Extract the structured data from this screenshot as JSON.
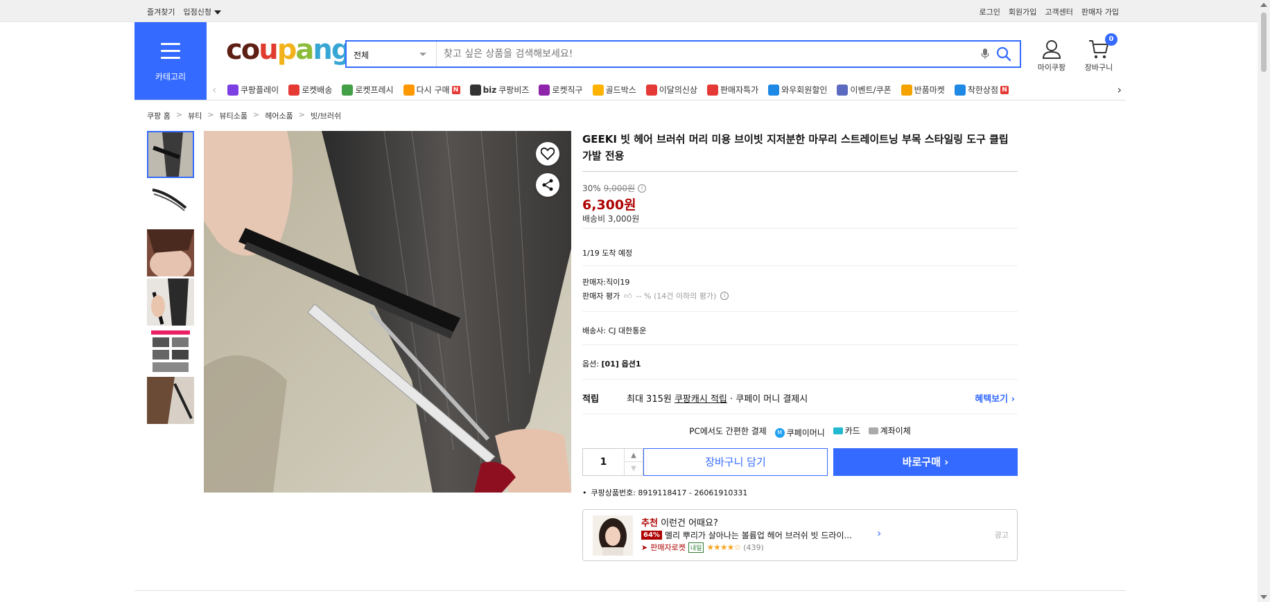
{
  "topbar": {
    "left": [
      "즐겨찾기",
      "입점신청"
    ],
    "right": [
      "로그인",
      "회원가입",
      "고객센터",
      "판매자 가입"
    ]
  },
  "header": {
    "category_label": "카테고리",
    "logo_text": "coupang",
    "search_category": "전체",
    "search_placeholder": "찾고 싶은 상품을 검색해보세요!",
    "mycoupang_label": "마이쿠팡",
    "cart_label": "장바구니",
    "cart_count": "0"
  },
  "nav": {
    "items": [
      {
        "label": "쿠팡플레이",
        "icon": "play-icon",
        "color": "#7b3fe4"
      },
      {
        "label": "로켓배송",
        "icon": "rocket-icon",
        "color": "#e53935"
      },
      {
        "label": "로켓프레시",
        "icon": "rocket-fresh-icon",
        "color": "#43a047"
      },
      {
        "label": "다시 구매",
        "icon": "bag-icon",
        "color": "#ff9800",
        "badge": "N"
      },
      {
        "label": "쿠팡비즈",
        "icon": "biz-icon",
        "color": "#333333",
        "prefix": "biz"
      },
      {
        "label": "로켓직구",
        "icon": "global-icon",
        "color": "#8e24aa"
      },
      {
        "label": "골드박스",
        "icon": "goldbox-icon",
        "color": "#ffb300"
      },
      {
        "label": "이달의신상",
        "icon": "new-icon",
        "color": "#e53935"
      },
      {
        "label": "판매자특가",
        "icon": "percent-icon",
        "color": "#e53935"
      },
      {
        "label": "와우회원할인",
        "icon": "wow-icon",
        "color": "#1e88e5"
      },
      {
        "label": "이벤트/쿠폰",
        "icon": "coupon-icon",
        "color": "#5c6bc0"
      },
      {
        "label": "반품마켓",
        "icon": "market-icon",
        "color": "#f4a300"
      },
      {
        "label": "착한상점",
        "icon": "store-icon",
        "color": "#1e88e5",
        "badge": "N"
      }
    ]
  },
  "breadcrumb": [
    "쿠팡 홈",
    "뷰티",
    "뷰티소품",
    "헤어소품",
    "빗/브러쉬"
  ],
  "product": {
    "title": "GEEKI 빗 헤어 브러쉬 머리 미용 브이빗 지저분한 마무리 스트레이트닝 부목 스타일링 도구 클립 가발 전용",
    "discount": "30%",
    "original_price": "9,000원",
    "price": "6,300원",
    "shipping": "배송비 3,000원",
    "arrival": "1/19 도착 예정",
    "seller_label": "판매자:",
    "seller": "직이19",
    "seller_rating_label": "판매자 평가",
    "seller_rating": "-- % (14건 이하의 평가)",
    "carrier_label": "배송사:",
    "carrier": "CJ 대한통운",
    "option_label": "옵션:",
    "option": "[01] 옵션1",
    "reward_label": "적립",
    "reward_prefix": "최대 315원",
    "reward_link": "쿠팡캐시 적립",
    "reward_suffix": "· 쿠페이 머니 결제시",
    "reward_more": "혜택보기",
    "pay_title": "PC에서도 간편한 결제",
    "pay_methods": [
      "쿠페이머니",
      "카드",
      "계좌이체"
    ],
    "quantity": "1",
    "add_to_cart": "장바구니 담기",
    "buy_now": "바로구매",
    "product_id": "쿠팡상품번호: 8919118417 - 26061910331"
  },
  "recommend": {
    "title_hot": "추천",
    "title": "이런건 어때요?",
    "discount": "64%",
    "name": "멜리 뿌리가 살아나는 볼륨업 헤어 브러쉬 빗 드라이...",
    "badge_rocket": "판매자로켓",
    "badge_tomorrow": "내일",
    "rating_stars": "★★★★☆",
    "rating_value": 4.5,
    "review_count": "(439)",
    "ad_label": "광고"
  },
  "colors": {
    "accent": "#346aff",
    "price_red": "#ae0000"
  }
}
